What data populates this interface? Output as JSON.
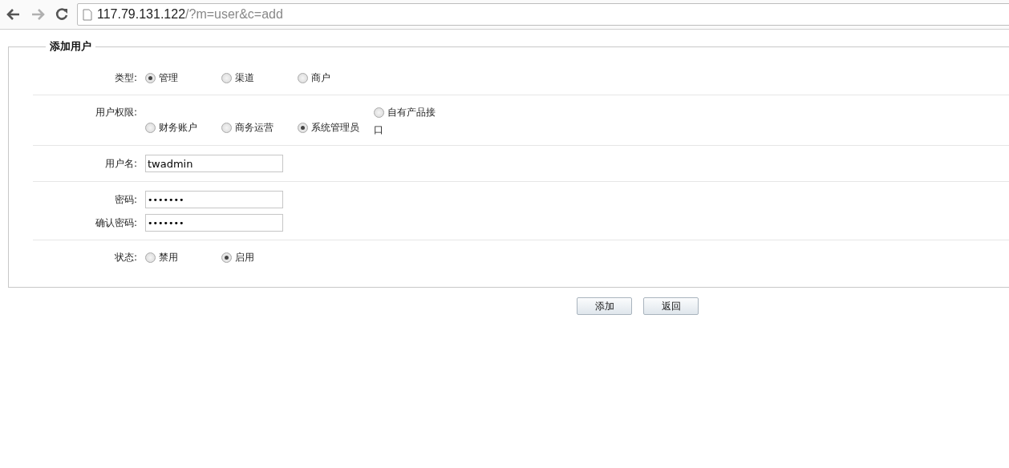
{
  "browser": {
    "back_disabled": false,
    "forward_disabled": true,
    "url_host": "117.79.131.122",
    "url_path": "/?m=user&c=add"
  },
  "form": {
    "legend": "添加用户",
    "type": {
      "label": "类型:",
      "options": [
        {
          "label": "管理",
          "selected": true
        },
        {
          "label": "渠道",
          "selected": false
        },
        {
          "label": "商户",
          "selected": false
        }
      ]
    },
    "permission": {
      "label": "用户权限:",
      "options": [
        {
          "label": "财务账户",
          "selected": false
        },
        {
          "label": "商务运营",
          "selected": false
        },
        {
          "label": "系统管理员",
          "selected": true
        },
        {
          "label": "自有产品接口",
          "selected": false
        }
      ]
    },
    "username": {
      "label": "用户名:",
      "value": "twadmin"
    },
    "password": {
      "label": "密码:",
      "value": "•••••••"
    },
    "confirm_password": {
      "label": "确认密码:",
      "value": "•••••••"
    },
    "status": {
      "label": "状态:",
      "options": [
        {
          "label": "禁用",
          "selected": false
        },
        {
          "label": "启用",
          "selected": true
        }
      ]
    },
    "buttons": [
      "添加",
      "返回"
    ]
  }
}
